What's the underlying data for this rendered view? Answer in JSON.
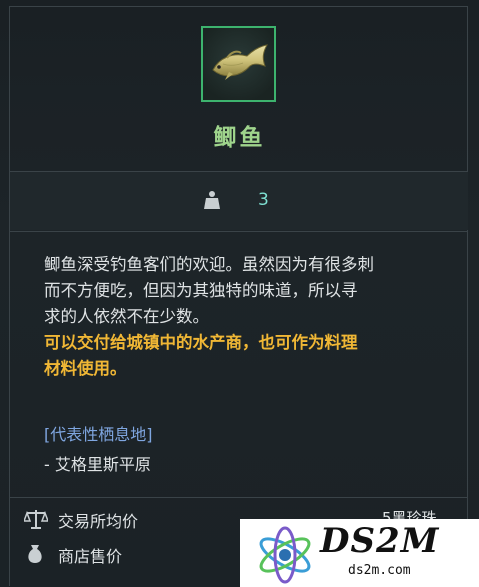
{
  "item": {
    "name": "鲫鱼",
    "icon": "crucian-carp-icon",
    "rarity_border_color": "#3db36e",
    "weight": "3"
  },
  "description": {
    "lines": [
      "鲫鱼深受钓鱼客们的欢迎。虽然因为有很多刺",
      "而不方便吃，但因为其独特的味道，所以寻",
      "求的人依然不在少数。"
    ],
    "highlight_lines": [
      "可以交付给城镇中的水产商，也可作为料理",
      "材料使用。"
    ]
  },
  "habitat": {
    "title": "[代表性栖息地]",
    "items": [
      "- 艾格里斯平原"
    ]
  },
  "prices": {
    "trade_label": "交易所均价",
    "trade_value": "5黑珍珠",
    "shop_label": "商店售价"
  },
  "watermark": {
    "logo_text": "DS2M",
    "url": "ds2m.com"
  }
}
